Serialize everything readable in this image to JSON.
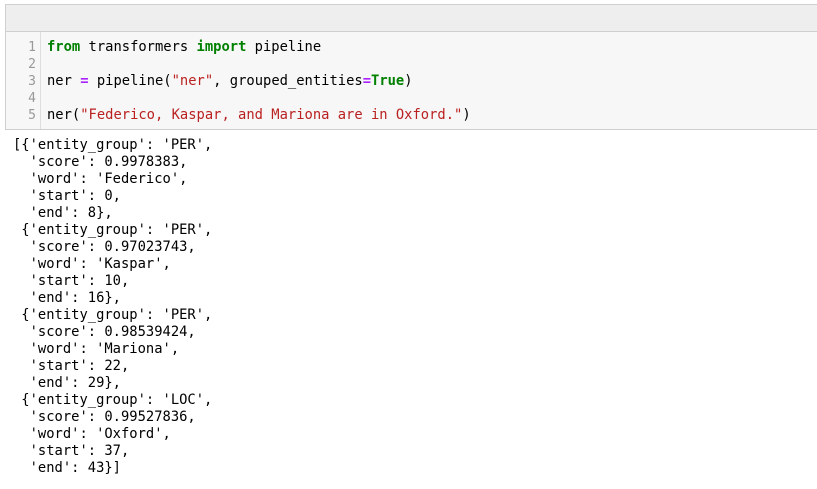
{
  "code_cell": {
    "line_numbers": [
      "1",
      "2",
      "3",
      "4",
      "5"
    ],
    "line1": {
      "kw_from": "from",
      "module": " transformers ",
      "kw_import": "import",
      "name": " pipeline"
    },
    "line3": {
      "var": "ner ",
      "op": "=",
      "call": " pipeline(",
      "str": "\"ner\"",
      "arg": ", grouped_entities",
      "op2": "=",
      "kw_true": "True",
      "close": ")"
    },
    "line5": {
      "call": "ner(",
      "str": "\"Federico, Kaspar, and Mariona are in Oxford.\"",
      "close": ")"
    }
  },
  "output": {
    "lines": [
      "[{'entity_group': 'PER',",
      "  'score': 0.9978383,",
      "  'word': 'Federico',",
      "  'start': 0,",
      "  'end': 8},",
      " {'entity_group': 'PER',",
      "  'score': 0.97023743,",
      "  'word': 'Kaspar',",
      "  'start': 10,",
      "  'end': 16},",
      " {'entity_group': 'PER',",
      "  'score': 0.98539424,",
      "  'word': 'Mariona',",
      "  'start': 22,",
      "  'end': 29},",
      " {'entity_group': 'LOC',",
      "  'score': 0.99527836,",
      "  'word': 'Oxford',",
      "  'start': 37,",
      "  'end': 43}]"
    ]
  }
}
